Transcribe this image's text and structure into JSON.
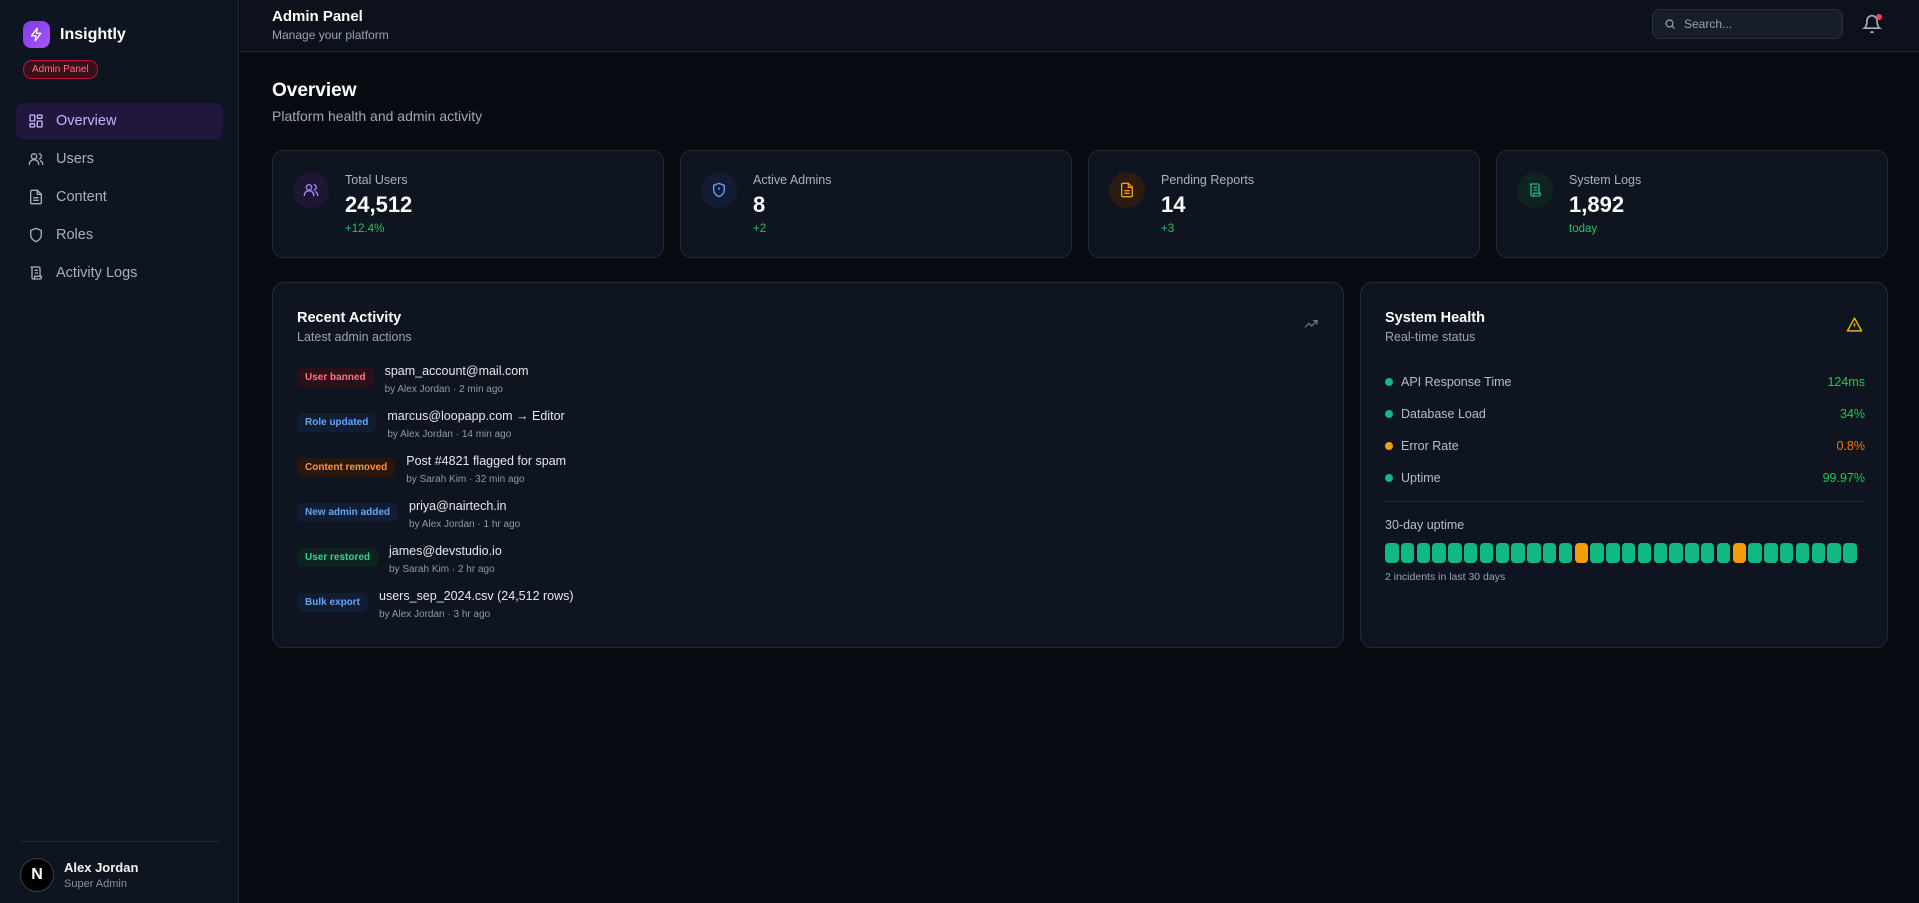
{
  "brand": {
    "name": "Insightly",
    "badge": "Admin Panel"
  },
  "nav": [
    {
      "label": "Overview",
      "icon": "grid-icon",
      "active": true
    },
    {
      "label": "Users",
      "icon": "users-icon",
      "active": false
    },
    {
      "label": "Content",
      "icon": "file-icon",
      "active": false
    },
    {
      "label": "Roles",
      "icon": "shield-icon",
      "active": false
    },
    {
      "label": "Activity Logs",
      "icon": "scroll-icon",
      "active": false
    }
  ],
  "user": {
    "initial": "N",
    "name": "Alex Jordan",
    "role": "Super Admin"
  },
  "header": {
    "title": "Admin Panel",
    "subtitle": "Manage your platform",
    "search_placeholder": "Search..."
  },
  "page": {
    "title": "Overview",
    "subtitle": "Platform health and admin activity"
  },
  "stats": [
    {
      "label": "Total Users",
      "value": "24,512",
      "delta": "+12.4%",
      "icon": "users-icon",
      "color": "#a78bfa"
    },
    {
      "label": "Active Admins",
      "value": "8",
      "delta": "+2",
      "icon": "shield-icon",
      "color": "#60a5fa"
    },
    {
      "label": "Pending Reports",
      "value": "14",
      "delta": "+3",
      "icon": "file-icon",
      "color": "#f59e0b"
    },
    {
      "label": "System Logs",
      "value": "1,892",
      "delta": "today",
      "icon": "scroll-icon",
      "color": "#10b981"
    }
  ],
  "activity": {
    "title": "Recent Activity",
    "subtitle": "Latest admin actions",
    "items": [
      {
        "badge": "User banned",
        "tone": "red",
        "text": "spam_account@mail.com",
        "meta": "by Alex Jordan · 2 min ago"
      },
      {
        "badge": "Role updated",
        "tone": "blue",
        "text": "marcus@loopapp.com → Editor",
        "meta": "by Alex Jordan · 14 min ago"
      },
      {
        "badge": "Content removed",
        "tone": "orange",
        "text": "Post #4821 flagged for spam",
        "meta": "by Sarah Kim · 32 min ago"
      },
      {
        "badge": "New admin added",
        "tone": "blue",
        "text": "priya@nairtech.in",
        "meta": "by Alex Jordan · 1 hr ago"
      },
      {
        "badge": "User restored",
        "tone": "green",
        "text": "james@devstudio.io",
        "meta": "by Sarah Kim · 2 hr ago"
      },
      {
        "badge": "Bulk export",
        "tone": "blue",
        "text": "users_sep_2024.csv (24,512 rows)",
        "meta": "by Alex Jordan · 3 hr ago"
      }
    ]
  },
  "health": {
    "title": "System Health",
    "subtitle": "Real-time status",
    "metrics": [
      {
        "label": "API Response Time",
        "value": "124ms",
        "status": "ok"
      },
      {
        "label": "Database Load",
        "value": "34%",
        "status": "ok"
      },
      {
        "label": "Error Rate",
        "value": "0.8%",
        "status": "warn"
      },
      {
        "label": "Uptime",
        "value": "99.97%",
        "status": "ok"
      }
    ],
    "uptime_title": "30-day uptime",
    "uptime_days": [
      "ok",
      "ok",
      "ok",
      "ok",
      "ok",
      "ok",
      "ok",
      "ok",
      "ok",
      "ok",
      "ok",
      "ok",
      "warn",
      "ok",
      "ok",
      "ok",
      "ok",
      "ok",
      "ok",
      "ok",
      "ok",
      "ok",
      "warn",
      "ok",
      "ok",
      "ok",
      "ok",
      "ok",
      "ok",
      "ok"
    ],
    "uptime_note": "2 incidents in last 30 days"
  },
  "colors": {
    "ok": "#10b981",
    "warn": "#f59e0b",
    "ok_text": "#22c55e",
    "warn_text": "#f97316",
    "accent": "#7c3aed"
  }
}
